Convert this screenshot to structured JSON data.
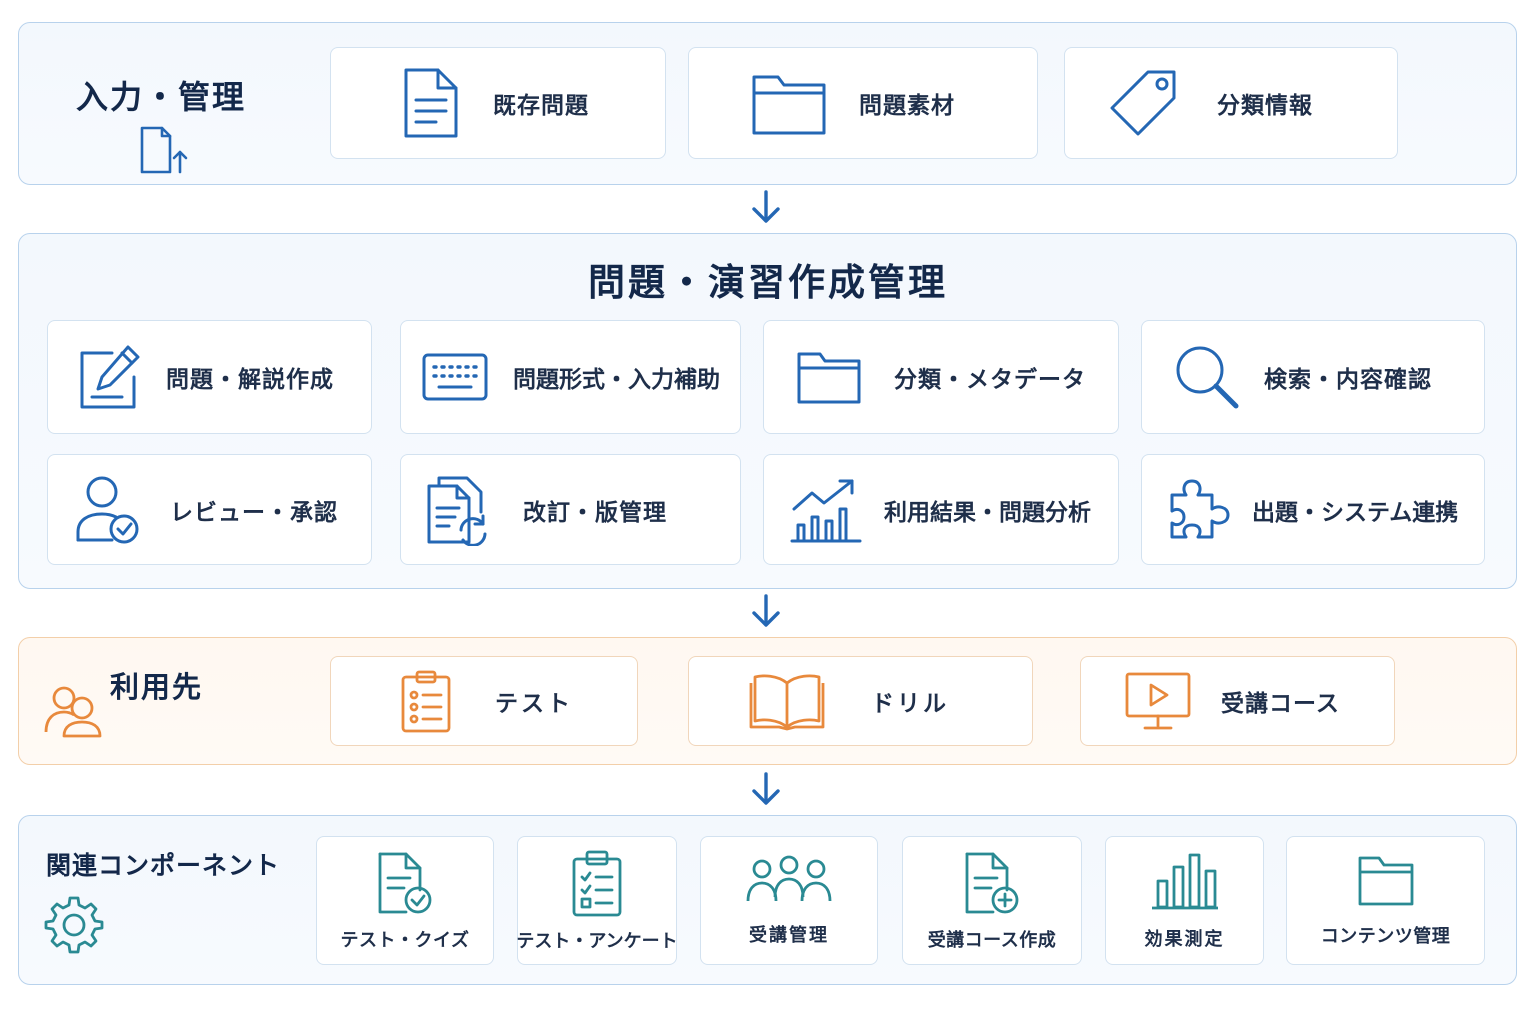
{
  "colors": {
    "blue": "#2467b4",
    "orange": "#e8893c",
    "teal": "#2a8a93",
    "title": "#13284a"
  },
  "input_section": {
    "title": "入力・管理",
    "icon": "file-upload-icon",
    "items": [
      {
        "label": "既存問題",
        "icon": "document-icon"
      },
      {
        "label": "問題素材",
        "icon": "folder-icon"
      },
      {
        "label": "分類情報",
        "icon": "tag-icon"
      }
    ]
  },
  "main_section": {
    "title": "問題・演習作成管理",
    "items": [
      {
        "label": "問題・解説作成",
        "icon": "edit-icon"
      },
      {
        "label": "問題形式・入力補助",
        "icon": "keyboard-icon"
      },
      {
        "label": "分類・メタデータ",
        "icon": "folder-icon"
      },
      {
        "label": "検索・内容確認",
        "icon": "search-icon"
      },
      {
        "label": "レビュー・承認",
        "icon": "user-check-icon"
      },
      {
        "label": "改訂・版管理",
        "icon": "document-sync-icon"
      },
      {
        "label": "利用結果・問題分析",
        "icon": "chart-trend-icon"
      },
      {
        "label": "出題・システム連携",
        "icon": "puzzle-icon"
      }
    ]
  },
  "usage_section": {
    "title": "利用先",
    "icon": "users-icon",
    "items": [
      {
        "label": "テスト",
        "icon": "clipboard-list-icon"
      },
      {
        "label": "ドリル",
        "icon": "book-icon"
      },
      {
        "label": "受講コース",
        "icon": "video-monitor-icon"
      }
    ]
  },
  "components_section": {
    "title": "関連コンポーネント",
    "icon": "gear-icon",
    "items": [
      {
        "label": "テスト・クイズ",
        "icon": "document-check-icon"
      },
      {
        "label": "テスト・アンケート",
        "icon": "clipboard-check-icon"
      },
      {
        "label": "受講管理",
        "icon": "group-icon"
      },
      {
        "label": "受講コース作成",
        "icon": "document-plus-icon"
      },
      {
        "label": "効果測定",
        "icon": "bar-chart-icon"
      },
      {
        "label": "コンテンツ管理",
        "icon": "folder-icon"
      }
    ]
  }
}
